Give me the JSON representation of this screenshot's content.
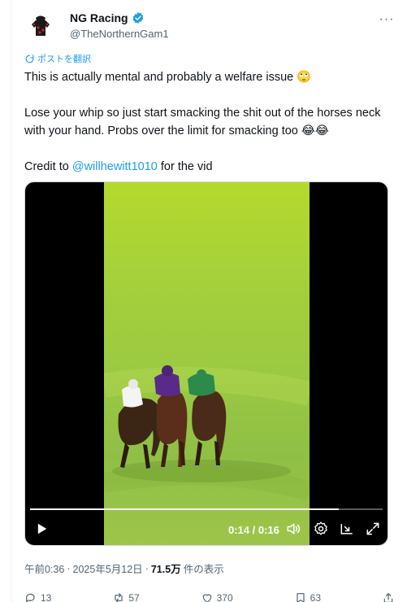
{
  "author": {
    "display_name": "NG Racing",
    "handle": "@TheNorthernGam1",
    "verified": true,
    "avatar_icon": "racing-silks-avatar"
  },
  "more_menu": {
    "label": "···"
  },
  "translate": {
    "label": "ポストを翻訳"
  },
  "tweet": {
    "line1": "This is actually mental and probably a welfare issue 🙄",
    "line2": "Lose your whip so just start smacking the shit out of the horses neck with your hand. Probs over the limit for smacking too 😂😂",
    "line3_prefix": "Credit to ",
    "mention": "@willhewitt1010",
    "line3_suffix": " for the vid"
  },
  "video": {
    "time": "0:14 / 0:16",
    "progress_fraction": 0.875,
    "icons": [
      "play-icon",
      "volume-icon",
      "settings-icon",
      "pip-icon",
      "fullscreen-icon"
    ]
  },
  "meta": {
    "time": "午前0:36",
    "sep1": "·",
    "date": "2025年5月12日",
    "sep2": "·",
    "views_count": "71.5万",
    "views_label": "件の表示"
  },
  "actions": {
    "reply": "13",
    "repost": "57",
    "like": "370",
    "bookmark": "63"
  },
  "colors": {
    "accent": "#1d9bf0",
    "text": "#0f1419",
    "muted": "#536471",
    "turf": "#a6d13a"
  }
}
